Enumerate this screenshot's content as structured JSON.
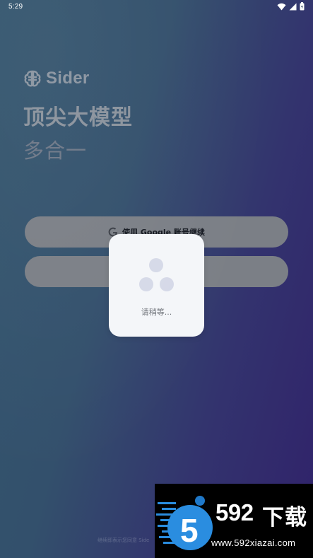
{
  "status_bar": {
    "time": "5:29",
    "icons": [
      "wifi-icon",
      "signal-icon",
      "battery-icon"
    ]
  },
  "brand": {
    "name": "Sider",
    "logo_icon": "brain-logo-icon"
  },
  "hero": {
    "headline": "顶尖大模型",
    "subheadline": "多合一"
  },
  "buttons": {
    "google_label": "使用 Google 账号继续",
    "second_label": ""
  },
  "loading": {
    "text": "请稍等..."
  },
  "footer": {
    "text": "继续即表示您同意 Side"
  },
  "watermark": {
    "number": "592",
    "word": "下载",
    "url": "www.592xiazai.com"
  },
  "colors": {
    "background_start": "#34566e",
    "background_end": "#30226a",
    "button": "#7b7f86",
    "dialog": "#f4f6f9",
    "dot": "#d5d9e8",
    "watermark_blue": "#2a8de0"
  }
}
